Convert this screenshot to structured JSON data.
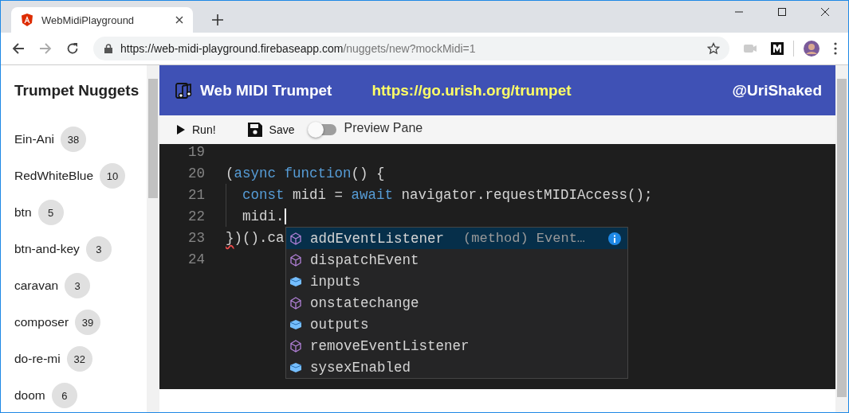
{
  "browser": {
    "tab_title": "WebMidiPlayground",
    "url_host": "https://web-midi-playground.firebaseapp.com",
    "url_path": "/nuggets/new?mockMidi=1"
  },
  "sidebar": {
    "title": "Trumpet Nuggets",
    "items": [
      {
        "name": "Ein-Ani",
        "count": "38"
      },
      {
        "name": "RedWhiteBlue",
        "count": "10"
      },
      {
        "name": "btn",
        "count": "5"
      },
      {
        "name": "btn-and-key",
        "count": "3"
      },
      {
        "name": "caravan",
        "count": "3"
      },
      {
        "name": "composer",
        "count": "39"
      },
      {
        "name": "do-re-mi",
        "count": "32"
      },
      {
        "name": "doom",
        "count": "6"
      }
    ]
  },
  "header": {
    "title": "Web MIDI Trumpet",
    "link": "https://go.urish.org/trumpet",
    "handle": "@UriShaked"
  },
  "toolbar": {
    "run": "Run!",
    "save": "Save",
    "preview": {
      "label": "Preview Pane",
      "on": false
    }
  },
  "editor": {
    "lines": [
      {
        "number": "19"
      },
      {
        "number": "20",
        "tokens": [
          {
            "text": "(",
            "kind": "text"
          },
          {
            "text": "async ",
            "kind": "keyword"
          },
          {
            "text": "function",
            "kind": "keyword"
          },
          {
            "text": "() {",
            "kind": "text"
          }
        ],
        "children": [
          {
            "number": "21",
            "tokens": [
              {
                "text": "const",
                "kind": "keyword"
              },
              {
                "text": " midi = ",
                "kind": "text"
              },
              {
                "text": "await",
                "kind": "keyword"
              },
              {
                "text": " navigator.requestMIDIAccess();",
                "kind": "text"
              }
            ]
          },
          {
            "number": "22",
            "cursor": true,
            "tokens": [
              {
                "text": "midi.",
                "kind": "text"
              }
            ]
          }
        ]
      },
      {
        "number": "23",
        "tokens": [
          {
            "text": "}",
            "kind": "error"
          },
          {
            "text": ")().ca",
            "kind": "text"
          }
        ]
      },
      {
        "number": "24"
      }
    ],
    "suggestions": [
      {
        "label": "addEventListener",
        "kind": "method",
        "selected": true,
        "detail": "(method) Event…"
      },
      {
        "label": "dispatchEvent",
        "kind": "method",
        "selected": false
      },
      {
        "label": "inputs",
        "kind": "property",
        "selected": false
      },
      {
        "label": "onstatechange",
        "kind": "method",
        "selected": false
      },
      {
        "label": "outputs",
        "kind": "property",
        "selected": false
      },
      {
        "label": "removeEventListener",
        "kind": "method",
        "selected": false
      },
      {
        "label": "sysexEnabled",
        "kind": "property",
        "selected": false
      }
    ]
  }
}
